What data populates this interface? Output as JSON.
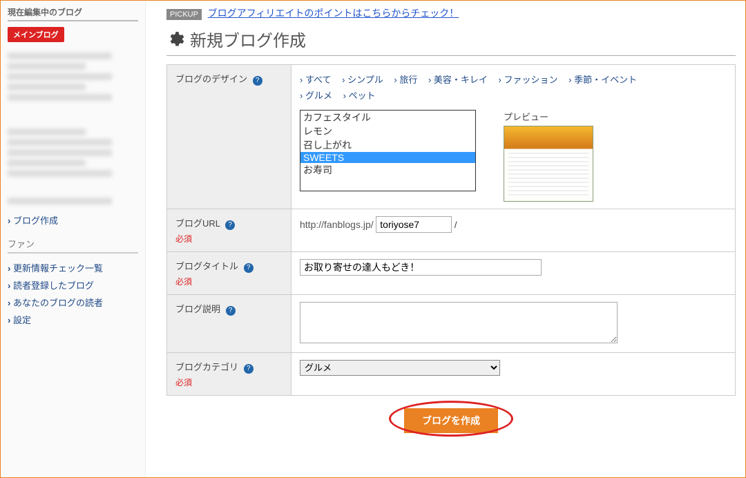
{
  "sidebar": {
    "heading": "現在編集中のブログ",
    "main_blog_badge": "メインブログ",
    "create_blog": "ブログ作成",
    "fan_heading": "ファン",
    "fan_links": [
      "更新情報チェック一覧",
      "読者登録したブログ",
      "あなたのブログの読者",
      "設定"
    ]
  },
  "pickup": {
    "badge": "PICKUP",
    "link": "ブログアフィリエイトのポイントはこちらからチェック！"
  },
  "page_title": "新規ブログ作成",
  "labels": {
    "design": "ブログのデザイン",
    "url": "ブログURL",
    "title": "ブログタイトル",
    "desc": "ブログ説明",
    "category": "ブログカテゴリ",
    "required": "必須",
    "preview": "プレビュー"
  },
  "categories": [
    "すべて",
    "シンプル",
    "旅行",
    "美容・キレイ",
    "ファッション",
    "季節・イベント",
    "グルメ",
    "ペット"
  ],
  "designs": [
    "カフェスタイル",
    "レモン",
    "召し上がれ",
    "SWEETS",
    "お寿司"
  ],
  "design_selected": "SWEETS",
  "url": {
    "prefix": "http://fanblogs.jp/",
    "value": "toriyose7",
    "suffix": "/"
  },
  "title_value": "お取り寄せの達人もどき！",
  "category_selected": "グルメ",
  "submit": "ブログを作成"
}
